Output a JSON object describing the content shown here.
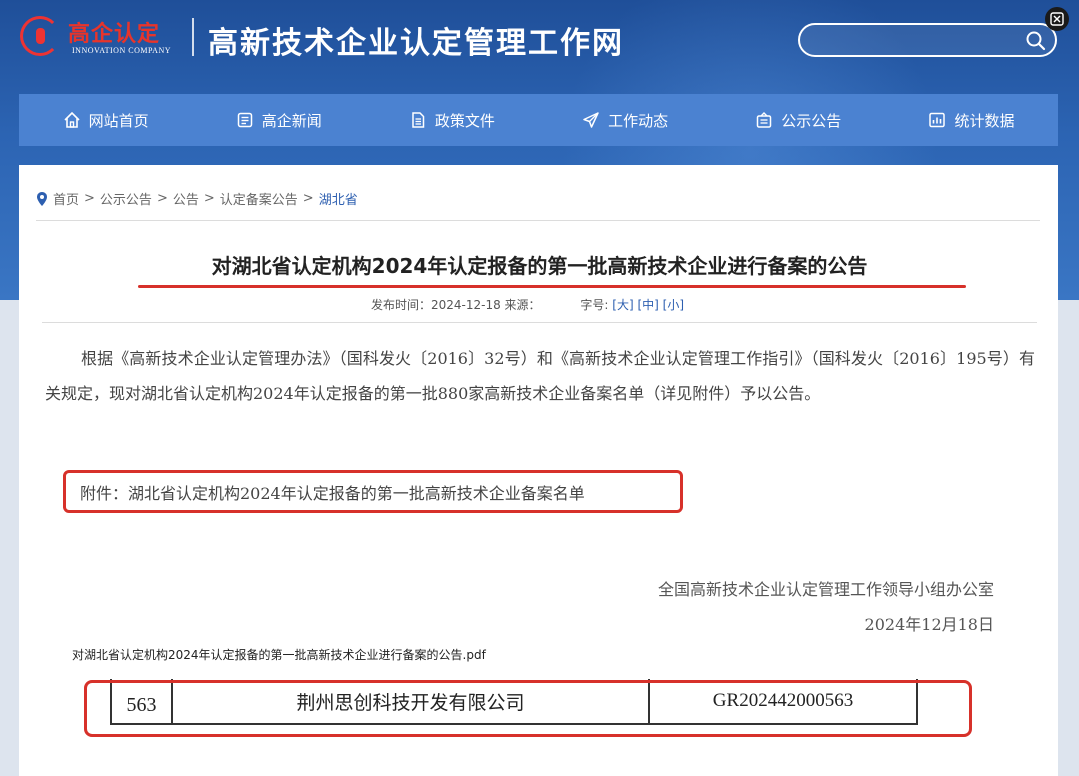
{
  "header": {
    "logo_cn": "高企认定",
    "logo_en": "INNOVATION COMPANY",
    "site_title": "高新技术企业认定管理工作网",
    "search": {
      "placeholder": "",
      "icon": "search-icon"
    }
  },
  "nav": {
    "items": [
      {
        "label": "网站首页",
        "icon": "home-icon"
      },
      {
        "label": "高企新闻",
        "icon": "news-icon"
      },
      {
        "label": "政策文件",
        "icon": "document-icon"
      },
      {
        "label": "工作动态",
        "icon": "paper-plane-icon"
      },
      {
        "label": "公示公告",
        "icon": "notice-icon"
      },
      {
        "label": "统计数据",
        "icon": "chart-icon"
      }
    ]
  },
  "breadcrumb": {
    "items": [
      "首页",
      "公示公告",
      "公告",
      "认定备案公告"
    ],
    "current": "湖北省",
    "separator": ">"
  },
  "article": {
    "title": "对湖北省认定机构2024年认定报备的第一批高新技术企业进行备案的公告",
    "meta_publish": "发布时间：2024-12-18 来源：",
    "meta_fontsize_label": "字号:",
    "font_sizes": [
      "[大]",
      "[中]",
      "[小]"
    ],
    "body": "根据《高新技术企业认定管理办法》（国科发火〔2016〕32号）和《高新技术企业认定管理工作指引》（国科发火〔2016〕195号）有关规定，现对湖北省认定机构2024年认定报备的第一批880家高新技术企业备案名单（详见附件）予以公告。",
    "attachment": "附件：湖北省认定机构2024年认定报备的第一批高新技术企业备案名单",
    "signer": "全国高新技术企业认定管理工作领导小组办公室",
    "date": "2024年12月18日"
  },
  "pdf_excerpt": {
    "filename": "对湖北省认定机构2024年认定报备的第一批高新技术企业进行备案的公告.pdf",
    "row": {
      "no": "563",
      "company": "荆州思创科技开发有限公司",
      "cert_no": "GR202442000563"
    }
  },
  "colors": {
    "nav_bg": "#4b82d1",
    "highlight": "#d7312a",
    "link": "#2d5fb0"
  }
}
